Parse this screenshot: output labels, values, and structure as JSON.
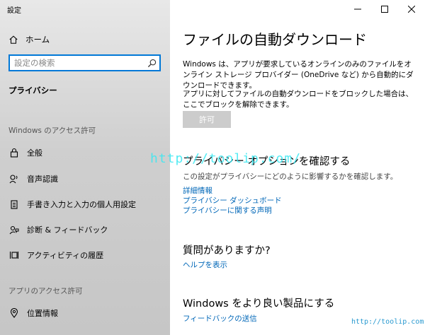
{
  "window": {
    "title": "設定"
  },
  "sidebar": {
    "home_label": "ホーム",
    "search_placeholder": "設定の検索",
    "current_section": "プライバシー",
    "group_windows": "Windows のアクセス許可",
    "windows_items": [
      {
        "label": "全般",
        "icon": "lock-icon"
      },
      {
        "label": "音声認識",
        "icon": "speech-icon"
      },
      {
        "label": "手書き入力と入力の個人用設定",
        "icon": "clipboard-icon"
      },
      {
        "label": "診断 & フィードバック",
        "icon": "feedback-icon"
      },
      {
        "label": "アクティビティの履歴",
        "icon": "activity-history-icon"
      }
    ],
    "group_apps": "アプリのアクセス許可",
    "app_items": [
      {
        "label": "位置情報",
        "icon": "location-icon"
      }
    ]
  },
  "main": {
    "title": "ファイルの自動ダウンロード",
    "description": "Windows は、アプリが要求しているオンラインのみのファイルをオンライン ストレージ プロバイダー (OneDrive など) から自動的にダウンロードできます。",
    "block_description": "アプリに対してファイルの自動ダウンロードをブロックした場合は、ここでブロックを解除できます。",
    "allow_button": "許可",
    "privacy_heading": "プライバシー オプションを確認する",
    "privacy_sub": "この設定がプライバシーにどのように影響するかを確認します。",
    "privacy_links": [
      "詳細情報",
      "プライバシー ダッシュボード",
      "プライバシーに関する声明"
    ],
    "question_heading": "質問がありますか?",
    "help_link": "ヘルプを表示",
    "improve_heading": "Windows をより良い製品にする",
    "feedback_link": "フィードバックの送信"
  },
  "watermarks": {
    "center": "http://toolip.com/",
    "corner": "http://toolip.com"
  },
  "colors": {
    "accent": "#0078d7",
    "link": "#0067b8",
    "disabled_button": "#cccccc"
  }
}
